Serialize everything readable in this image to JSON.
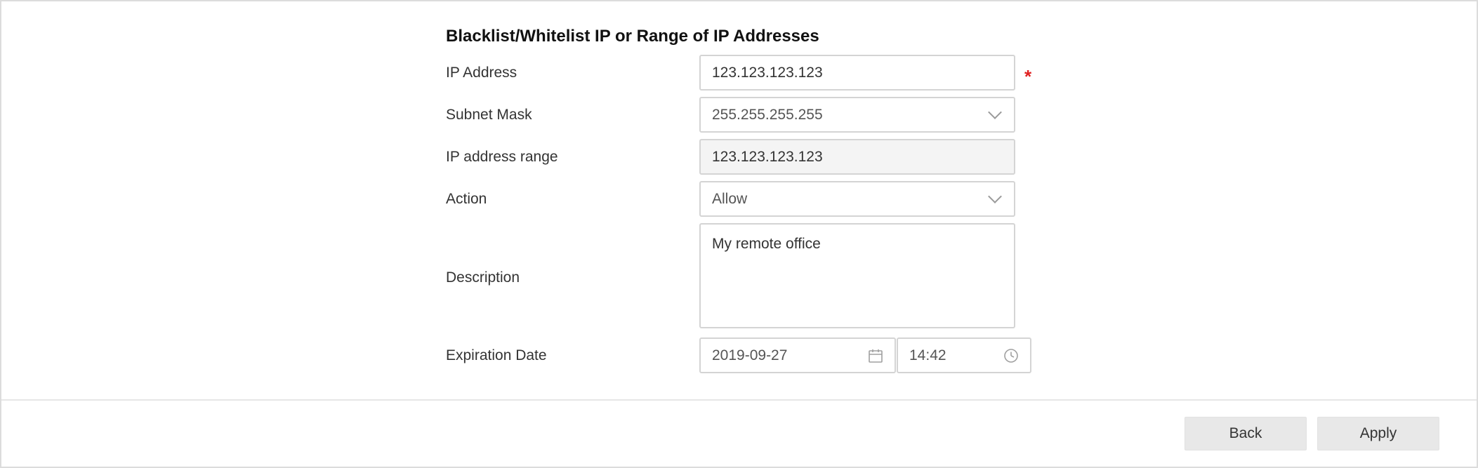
{
  "form": {
    "title": "Blacklist/Whitelist IP or Range of IP Addresses",
    "required_marker": "*",
    "ip_address": {
      "label": "IP Address",
      "value": "123.123.123.123"
    },
    "subnet_mask": {
      "label": "Subnet Mask",
      "value": "255.255.255.255",
      "icon": "chevron-down-icon"
    },
    "ip_range": {
      "label": "IP address range",
      "value": "123.123.123.123"
    },
    "action": {
      "label": "Action",
      "value": "Allow",
      "icon": "chevron-down-icon"
    },
    "description": {
      "label": "Description",
      "value": "My remote office"
    },
    "expiration": {
      "label": "Expiration Date",
      "date": "2019-09-27",
      "time": "14:42",
      "date_icon": "calendar-icon",
      "time_icon": "clock-icon"
    }
  },
  "footer": {
    "back_label": "Back",
    "apply_label": "Apply"
  },
  "colors": {
    "required": "#e02020",
    "button_bg": "#e8e8e8",
    "readonly_bg": "#f4f4f4",
    "border": "#d4d4d4"
  }
}
